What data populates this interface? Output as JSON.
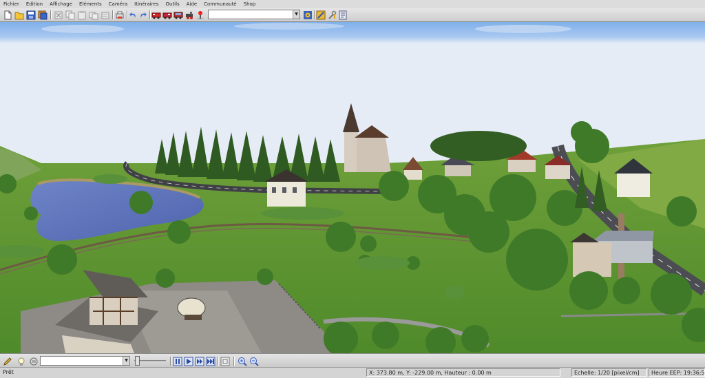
{
  "menu": [
    "Fichier",
    "Edition",
    "Affichage",
    "Eléments",
    "Caméra",
    "Itinéraires",
    "Outils",
    "Aide",
    "Communauté",
    "Shop"
  ],
  "toolbar": {
    "buttons": [
      "new-file",
      "open-folder",
      "save",
      "save-all",
      "cut",
      "copy",
      "paste",
      "duplicate",
      "delete",
      "print",
      "undo",
      "redo",
      "train-red-1",
      "train-red-2",
      "train-red-3",
      "train-tools",
      "settings-cog",
      "track-tool",
      "info-panel",
      "signal-tool"
    ],
    "search_value": ""
  },
  "viewport": {
    "scene": "3d-landscape",
    "sky_color": "#8fb8ea"
  },
  "bottom_toolbar": {
    "combo_value": "",
    "buttons": [
      "edit",
      "bulb",
      "print-bottom",
      "pause",
      "play",
      "fast-forward",
      "fast-forward-2",
      "step",
      "screenshot",
      "zoom-in",
      "zoom-out"
    ]
  },
  "status": {
    "ready": "Prêt",
    "coords": "X: 373.80 m, Y: -229.00 m, Hauteur : 0.00 m",
    "scale": "Echelle: 1/20 [pixel/cm]",
    "time": "Heure EEP: 19:36:5"
  }
}
